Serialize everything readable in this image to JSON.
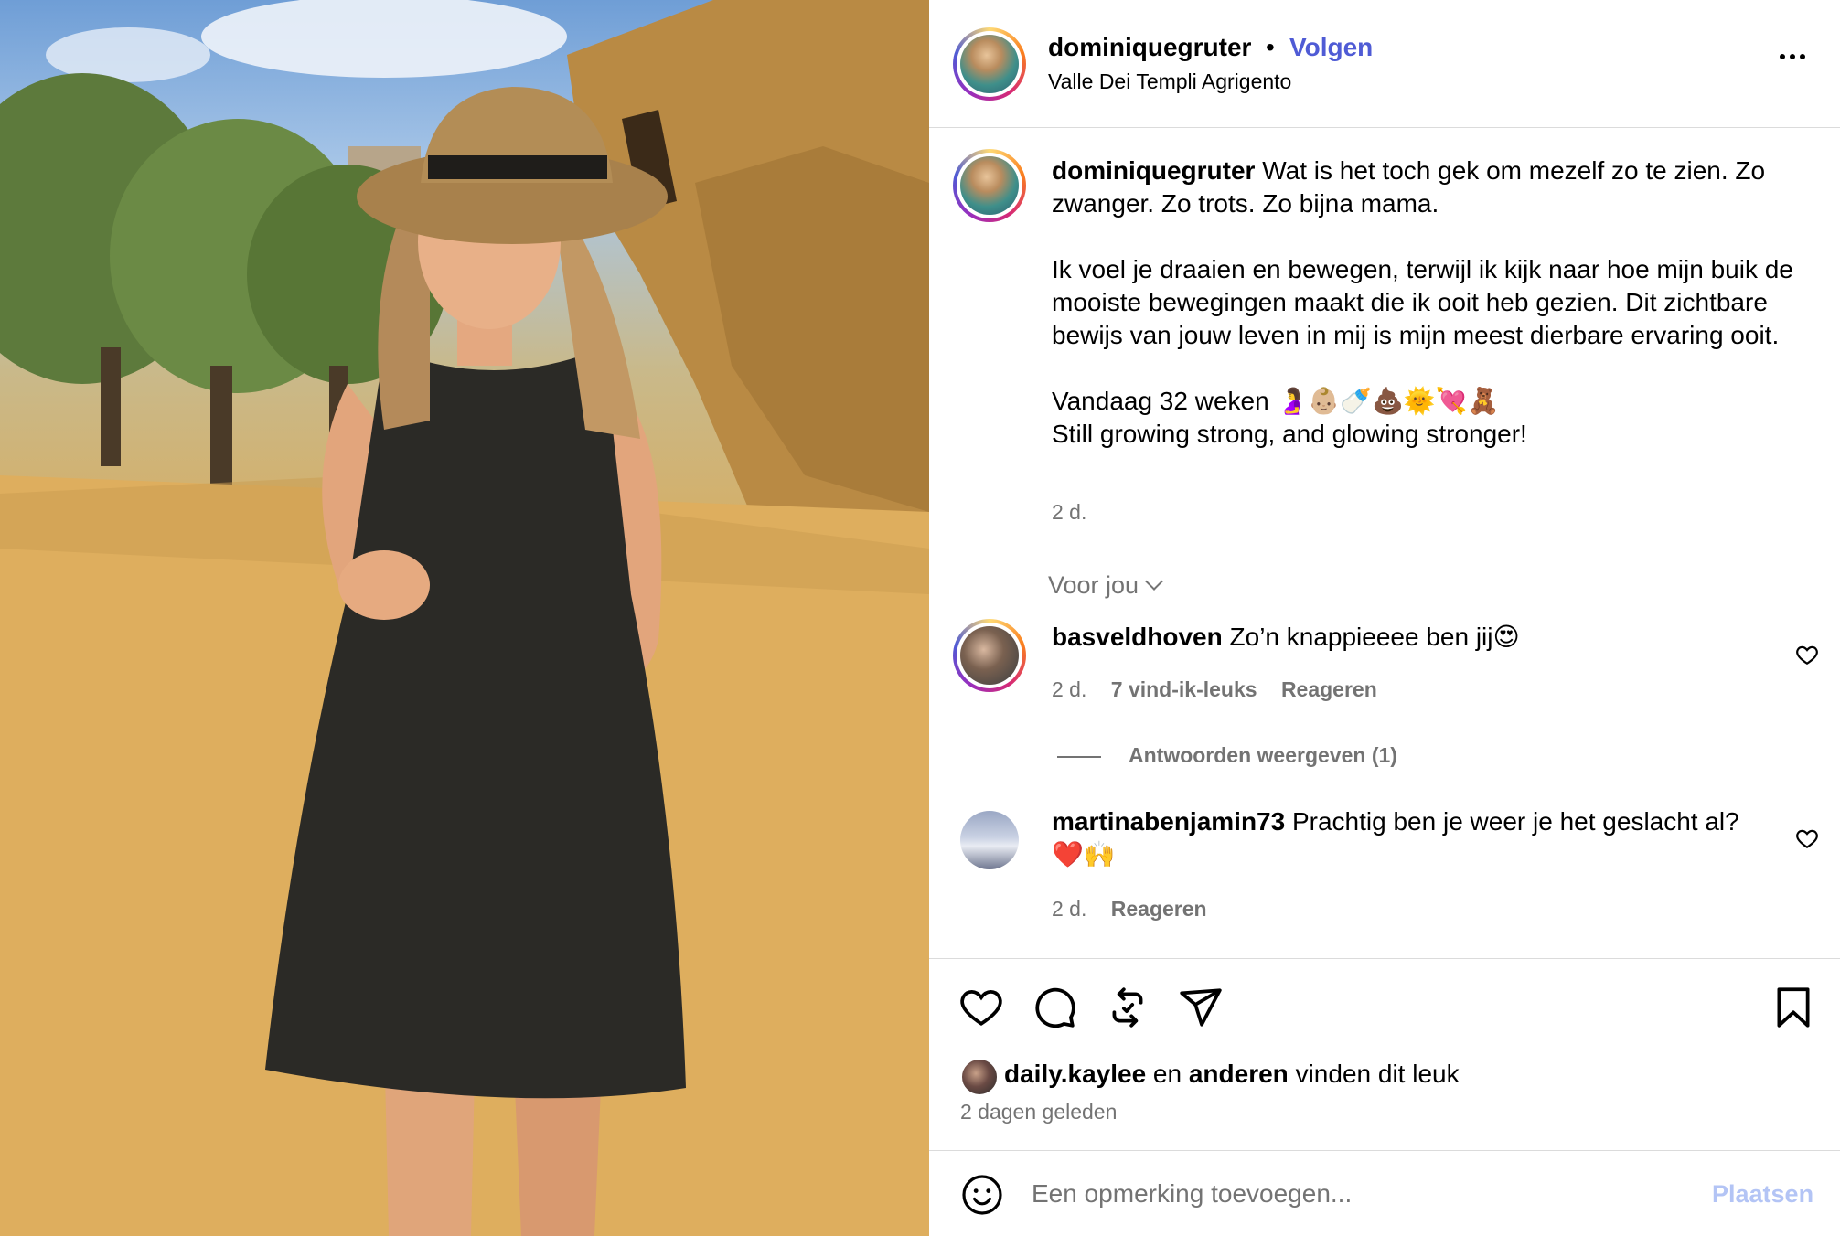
{
  "post": {
    "username": "dominiquegruter",
    "separator": "•",
    "follow_label": "Volgen",
    "location": "Valle Dei Templi Agrigento",
    "more_icon": "more-horizontal-icon"
  },
  "caption": {
    "username": "dominiquegruter",
    "line1": "Wat is het toch gek om mezelf zo te zien. Zo zwanger. Zo trots. Zo bijna mama.",
    "paragraph2": "Ik voel je draaien en bewegen, terwijl ik kijk naar hoe mijn buik de mooiste bewegingen maakt die ik ooit heb gezien. Dit zichtbare bewijs van jouw leven in mij is mijn meest dierbare ervaring ooit.",
    "paragraph3a": "Vandaag 32 weken 🤰👶🏼🍼💩🌞💘🧸",
    "paragraph3b": "Still growing strong, and glowing stronger!",
    "time": "2 d."
  },
  "for_you_label": "Voor jou",
  "comments": [
    {
      "username": "basveldhoven",
      "text": "Zo’n knappieeee ben jij😍",
      "time": "2 d.",
      "likes": "7 vind-ik-leuks",
      "reply_label": "Reageren",
      "view_replies": "Antwoorden weergeven (1)"
    },
    {
      "username": "martinabenjamin73",
      "text": "Prachtig ben je weer je het geslacht al? ❤️🙌",
      "time": "2 d.",
      "reply_label": "Reageren"
    }
  ],
  "likes_line": {
    "user": "daily.kaylee",
    "middle": " en ",
    "others": "anderen",
    "suffix": " vinden dit leuk"
  },
  "posted_ago": "2 dagen geleden",
  "add_comment": {
    "placeholder": "Een opmerking toevoegen...",
    "post_label": "Plaatsen"
  },
  "colors": {
    "accent": "#4f5bd5",
    "muted_text": "#737373",
    "divider": "#dbdbdb",
    "post_button_disabled": "#b3c4f5"
  }
}
